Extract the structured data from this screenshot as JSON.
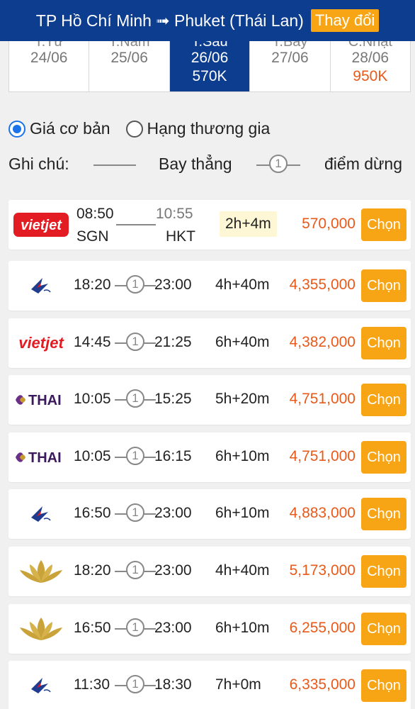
{
  "header": {
    "title": "TP Hồ Chí Minh ➟ Phuket (Thái Lan)",
    "change_label": "Thay đổi"
  },
  "dates": [
    {
      "dow": "T.Tư",
      "date": "24/06",
      "price": "",
      "active": false
    },
    {
      "dow": "T.Năm",
      "date": "25/06",
      "price": "",
      "active": false
    },
    {
      "dow": "T.Sáu",
      "date": "26/06",
      "price": "570K",
      "active": true
    },
    {
      "dow": "T.Bảy",
      "date": "27/06",
      "price": "",
      "active": false
    },
    {
      "dow": "C.Nhật",
      "date": "28/06",
      "price": "950K",
      "active": false
    }
  ],
  "options": {
    "basic": "Giá cơ bản",
    "business": "Hạng thương gia"
  },
  "legend": {
    "label": "Ghi chú:",
    "direct": "Bay thẳng",
    "stop_number": "1",
    "stop_label": "điểm dừng"
  },
  "choose_label": "Chọn",
  "flights": [
    {
      "airline": "vietjet",
      "logo_text": "vietjet",
      "dep": "08:50",
      "arr": "10:55",
      "from": "SGN",
      "to": "HKT",
      "duration": "2h+4m",
      "price": "570,000",
      "stops": "0"
    },
    {
      "airline": "bangkok-airways",
      "logo_text": "",
      "dep": "18:20",
      "arr": "23:00",
      "duration": "4h+40m",
      "price": "4,355,000",
      "stops": "1"
    },
    {
      "airline": "vietjet",
      "logo_text": "vietjet",
      "dep": "14:45",
      "arr": "21:25",
      "duration": "6h+40m",
      "price": "4,382,000",
      "stops": "1"
    },
    {
      "airline": "thai",
      "logo_text": "THAI",
      "dep": "10:05",
      "arr": "15:25",
      "duration": "5h+20m",
      "price": "4,751,000",
      "stops": "1"
    },
    {
      "airline": "thai",
      "logo_text": "THAI",
      "dep": "10:05",
      "arr": "16:15",
      "duration": "6h+10m",
      "price": "4,751,000",
      "stops": "1"
    },
    {
      "airline": "bangkok-airways",
      "logo_text": "",
      "dep": "16:50",
      "arr": "23:00",
      "duration": "6h+10m",
      "price": "4,883,000",
      "stops": "1"
    },
    {
      "airline": "vietnam-airlines",
      "logo_text": "",
      "dep": "18:20",
      "arr": "23:00",
      "duration": "4h+40m",
      "price": "5,173,000",
      "stops": "1"
    },
    {
      "airline": "vietnam-airlines",
      "logo_text": "",
      "dep": "16:50",
      "arr": "23:00",
      "duration": "6h+10m",
      "price": "6,255,000",
      "stops": "1"
    },
    {
      "airline": "bangkok-airways",
      "logo_text": "",
      "dep": "11:30",
      "arr": "18:30",
      "duration": "7h+0m",
      "price": "6,335,000",
      "stops": "1"
    }
  ]
}
